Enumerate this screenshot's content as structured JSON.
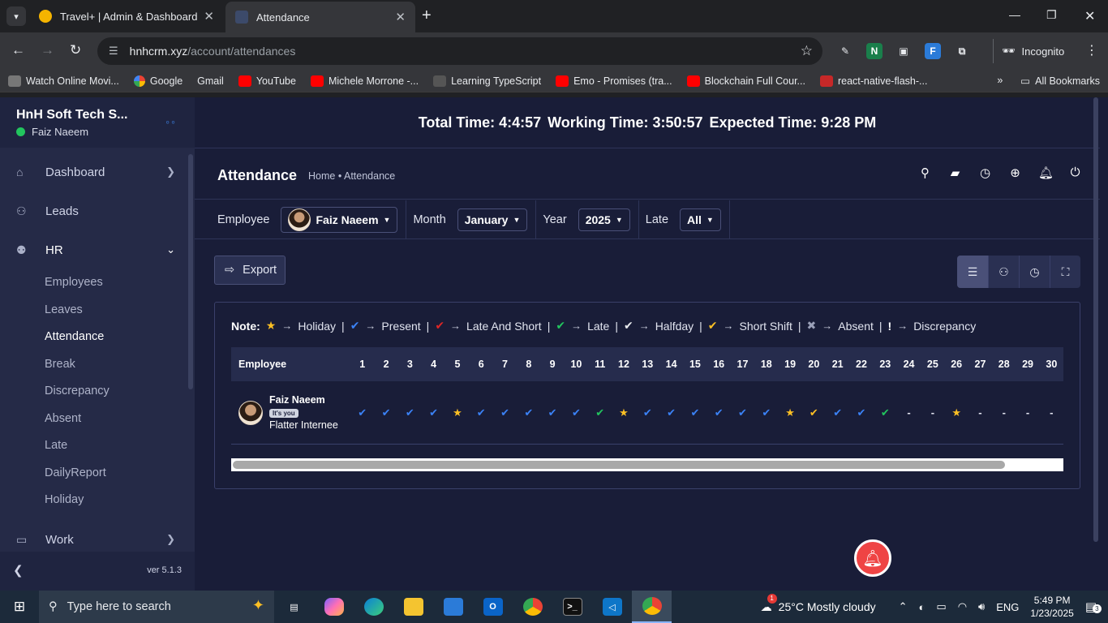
{
  "browser": {
    "tabs": [
      {
        "title": "Travel+ | Admin & Dashboard",
        "active": false
      },
      {
        "title": "Attendance",
        "active": true
      }
    ],
    "url_host": "hnhcrm.xyz",
    "url_path": "/account/attendances",
    "incognito_label": "Incognito",
    "bookmarks": [
      "Watch Online Movi...",
      "Google",
      "Gmail",
      "YouTube",
      "Michele Morrone -...",
      "Learning TypeScript",
      "Emo - Promises (tra...",
      "Blockchain Full Cour...",
      "react-native-flash-..."
    ],
    "all_bookmarks_label": "All Bookmarks"
  },
  "sidebar": {
    "company": "HnH Soft Tech S...",
    "user": "Faiz Naeem",
    "nav": {
      "dashboard": "Dashboard",
      "leads": "Leads",
      "hr": "HR",
      "work": "Work"
    },
    "hr_items": [
      "Employees",
      "Leaves",
      "Attendance",
      "Break",
      "Discrepancy",
      "Absent",
      "Late",
      "DailyReport",
      "Holiday"
    ],
    "version": "ver 5.1.3"
  },
  "timebar": {
    "total": "Total Time: 4:4:57",
    "working": "Working Time: 3:50:57",
    "expected": "Expected Time: 9:28 PM"
  },
  "header": {
    "title": "Attendance",
    "breadcrumb": "Home • Attendance"
  },
  "filters": {
    "employee_label": "Employee",
    "employee_value": "Faiz Naeem",
    "month_label": "Month",
    "month_value": "January",
    "year_label": "Year",
    "year_value": "2025",
    "late_label": "Late",
    "late_value": "All"
  },
  "export_label": "Export",
  "legend": {
    "note": "Note:",
    "holiday": "Holiday",
    "present": "Present",
    "late_short": "Late And Short",
    "late": "Late",
    "halfday": "Halfday",
    "short_shift": "Short Shift",
    "absent": "Absent",
    "discrepancy": "Discrepancy"
  },
  "table": {
    "employee_header": "Employee",
    "days": [
      "1",
      "2",
      "3",
      "4",
      "5",
      "6",
      "7",
      "8",
      "9",
      "10",
      "11",
      "12",
      "13",
      "14",
      "15",
      "16",
      "17",
      "18",
      "19",
      "20",
      "21",
      "22",
      "23",
      "24",
      "25",
      "26",
      "27",
      "28",
      "29",
      "30"
    ],
    "rows": [
      {
        "name": "Faiz Naeem",
        "badge": "It's you",
        "role": "Flatter Internee",
        "marks": [
          "present",
          "present",
          "present",
          "present",
          "holiday",
          "present",
          "present",
          "present",
          "present",
          "present",
          "late",
          "holiday",
          "present",
          "present",
          "present",
          "present",
          "present",
          "present",
          "holiday",
          "short",
          "present",
          "present",
          "late",
          "none",
          "none",
          "holiday",
          "none",
          "none",
          "none",
          "none"
        ]
      }
    ]
  },
  "symbols": {
    "present": "✔",
    "holiday": "★",
    "late": "✔",
    "short": "✔",
    "none": "-"
  },
  "colors": {
    "present": "#3b82f6",
    "holiday": "#fbbf24",
    "late": "#22c55e",
    "short": "#fbbf24",
    "none": "#e2e5f0"
  },
  "taskbar": {
    "search_placeholder": "Type here to search",
    "weather": "25°C  Mostly cloudy",
    "weather_badge": "1",
    "lang": "ENG",
    "time": "5:49 PM",
    "date": "1/23/2025",
    "notif_count": "3"
  }
}
